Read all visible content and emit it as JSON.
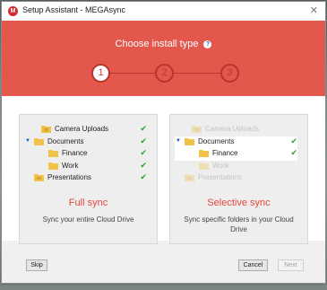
{
  "window": {
    "title": "Setup Assistant - MEGAsync",
    "logo_letter": "M",
    "close_glyph": "✕"
  },
  "header": {
    "heading": "Choose install type",
    "help_glyph": "?"
  },
  "steps": [
    "1",
    "2",
    "3"
  ],
  "options": {
    "full": {
      "title": "Full sync",
      "description": "Sync your entire Cloud Drive",
      "tree": [
        {
          "label": "Camera Uploads",
          "checked": true
        },
        {
          "label": "Documents",
          "checked": true,
          "expanded": true
        },
        {
          "label": "Finance",
          "checked": true
        },
        {
          "label": "Work",
          "checked": true
        },
        {
          "label": "Presentations",
          "checked": true
        }
      ]
    },
    "selective": {
      "title": "Selective sync",
      "description": "Sync specific folders in your Cloud Drive",
      "tree": [
        {
          "label": "Camera Uploads",
          "checked": false
        },
        {
          "label": "Documents",
          "checked": true,
          "expanded": true
        },
        {
          "label": "Finance",
          "checked": true
        },
        {
          "label": "Work",
          "checked": false
        },
        {
          "label": "Presentations",
          "checked": false
        }
      ]
    }
  },
  "buttons": {
    "skip": "Skip",
    "cancel": "Cancel",
    "next": "Next"
  },
  "colors": {
    "accent": "#e4574d",
    "title_red": "#e3463c",
    "check_green": "#2c9a2c",
    "help_blue": "#1a64d6"
  }
}
